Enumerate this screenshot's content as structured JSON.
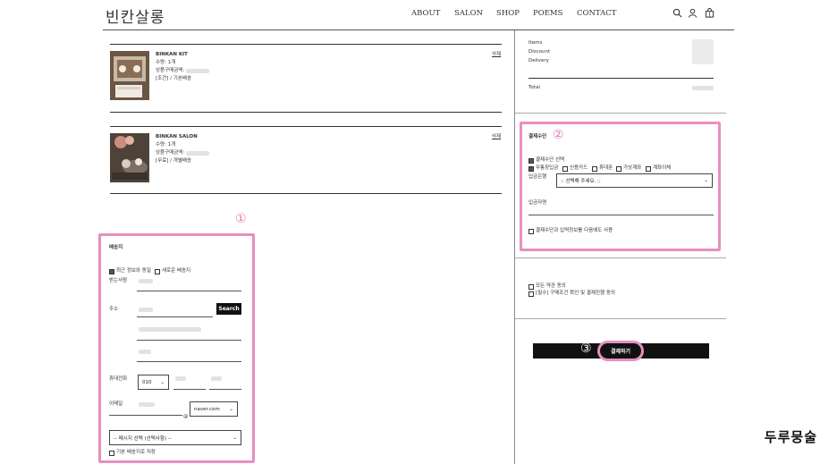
{
  "header": {
    "logo": "빈칸살롱",
    "nav": [
      "ABOUT",
      "SALON",
      "SHOP",
      "POEMS",
      "CONTACT"
    ]
  },
  "cart": {
    "items": [
      {
        "name": "BINKAN KIT",
        "qty": "수량: 1개",
        "price_label": "상품구매금액:",
        "ship": "[조건] / 기본배송",
        "delete": "삭제"
      },
      {
        "name": "BINKAN SALON",
        "qty": "수량: 1개",
        "price_label": "상품구매금액:",
        "ship": "[무료] / 개별배송",
        "delete": "삭제"
      }
    ]
  },
  "shipping": {
    "marker": "①",
    "title": "배송지",
    "opt_recent": "최근 정보와 동일",
    "opt_new": "새로운 배송지",
    "recipient_label": "받는사람",
    "address_label": "주소",
    "search_btn": "Search",
    "phone_label": "휴대전화",
    "phone_prefix": "010",
    "email_label": "이메일",
    "email_at": "@",
    "email_domain": "naver.com",
    "message_select": "-- 메시지 선택 (선택사항) --",
    "save_default": "기본 배송지로 저장"
  },
  "summary": {
    "items_label": "Items",
    "discount_label": "Discount",
    "delivery_label": "Delivery",
    "total_label": "Total"
  },
  "payment": {
    "marker": "②",
    "title": "결제수단",
    "select_label": "결제수단 선택",
    "methods": [
      "무통장입금",
      "신용카드",
      "휴대폰",
      "가상계좌",
      "계좌이체"
    ],
    "bank_label": "입금은행",
    "bank_select": ":: 선택해 주세요. ::",
    "depositor_label": "입금자명",
    "reuse": "결제수단과 입력정보를 다음에도 사용"
  },
  "agree": {
    "all": "모든 약관 동의",
    "required": "[필수] 구매조건 확인 및 결제진행 동의"
  },
  "checkout": {
    "marker": "③",
    "button": "결제하기"
  },
  "signature": "두루뭉술"
}
